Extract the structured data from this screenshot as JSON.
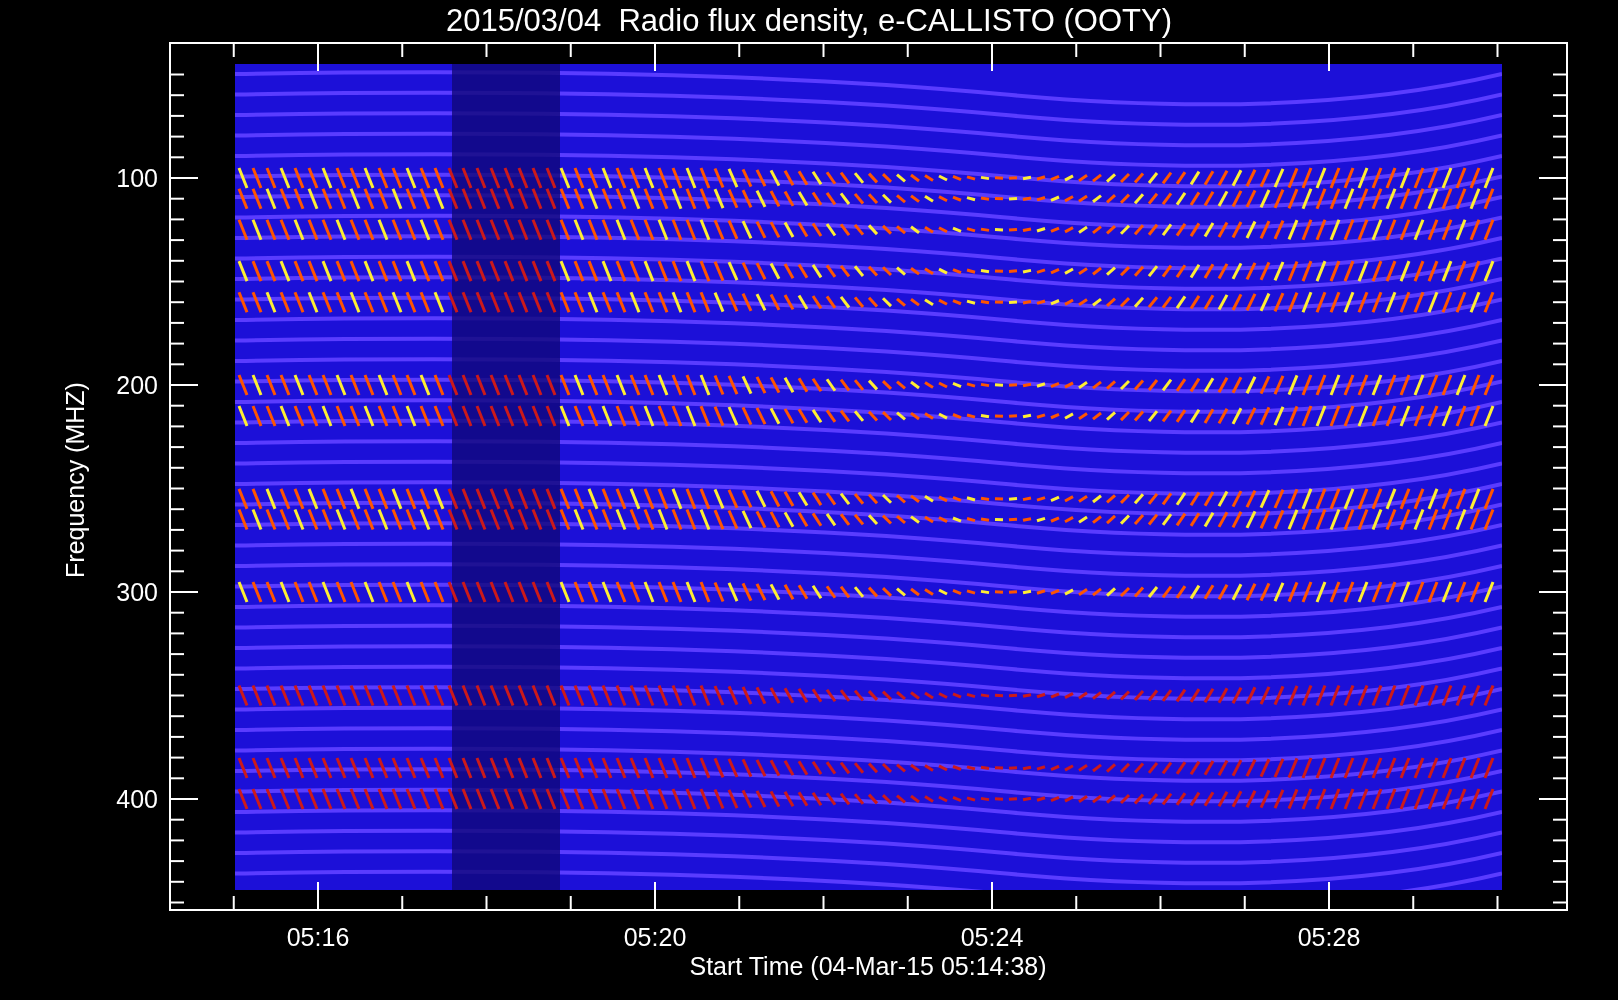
{
  "title": "2015/03/04  Radio flux density, e-CALLISTO (OOTY)",
  "y_axis": {
    "label": "Frequency (MHZ)",
    "ticks": [
      "100",
      "200",
      "300",
      "400"
    ]
  },
  "x_axis": {
    "label": "Start Time (04-Mar-15 05:14:38)",
    "ticks": [
      "05:16",
      "05:20",
      "05:24",
      "05:28"
    ]
  }
}
